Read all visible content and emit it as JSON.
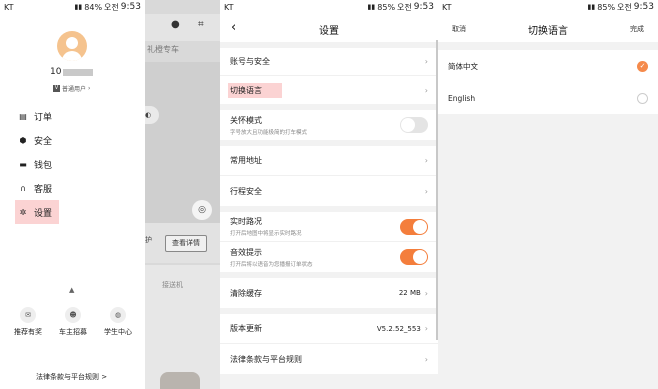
{
  "status_p1": {
    "carrier": "KT",
    "battery": "84%",
    "ampm": "오전",
    "time": "9:53"
  },
  "status_p2": {
    "carrier": "KT",
    "battery": "85%",
    "ampm": "오전",
    "time": "9:53"
  },
  "status_p3": {
    "carrier": "KT",
    "battery": "85%",
    "ampm": "오전",
    "time": "9:53"
  },
  "drawer": {
    "user_id_prefix": "10",
    "member_level": "普通用户",
    "menu": [
      {
        "icon": "order-icon",
        "label": "订单"
      },
      {
        "icon": "shield-icon",
        "label": "安全"
      },
      {
        "icon": "wallet-icon",
        "label": "钱包"
      },
      {
        "icon": "headset-icon",
        "label": "客服"
      },
      {
        "icon": "gear-icon",
        "label": "设置"
      }
    ],
    "quick": [
      {
        "icon": "gift-icon",
        "label": "推荐有奖"
      },
      {
        "icon": "driver-icon",
        "label": "车主招募"
      },
      {
        "icon": "student-icon",
        "label": "学生中心"
      }
    ],
    "legal": "法律条款与平台规则 >"
  },
  "background": {
    "tab_text": "礼橙专车",
    "card_hint": "护",
    "detail_button": "查看详情",
    "pickup": "接送机"
  },
  "settings": {
    "title": "设置",
    "account_security": "账号与安全",
    "switch_language": "切换语言",
    "care_mode": "关怀模式",
    "care_mode_desc": "字号放大且功能极简的打车模式",
    "care_mode_on": false,
    "common_address": "常用地址",
    "trip_safety": "行程安全",
    "live_traffic": "实时路况",
    "live_traffic_desc": "打开后地图中将显示实时路况",
    "live_traffic_on": true,
    "sound_tips": "音效提示",
    "sound_tips_desc": "打开后将以语音为您播报订单状态",
    "sound_tips_on": true,
    "clear_cache": "清除缓存",
    "cache_size": "22 MB",
    "version_update": "版本更新",
    "version": "V5.2.52_553",
    "legal": "法律条款与平台规则"
  },
  "language": {
    "cancel": "取消",
    "title": "切换语言",
    "done": "完成",
    "options": [
      {
        "label": "简体中文",
        "selected": true
      },
      {
        "label": "English",
        "selected": false
      }
    ]
  },
  "colors": {
    "accent": "#f47e3c",
    "highlight": "#fbd3d3"
  }
}
